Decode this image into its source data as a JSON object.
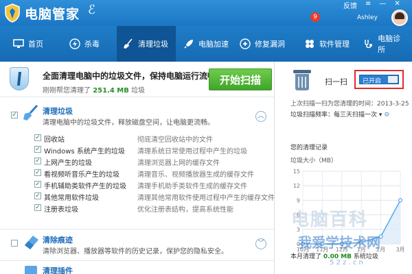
{
  "app": {
    "title": "电脑管家",
    "user": "Ashley",
    "feedback": "反馈"
  },
  "nav": {
    "items": [
      {
        "label": "首页",
        "icon": "monitor-icon"
      },
      {
        "label": "杀毒",
        "icon": "lightning-icon"
      },
      {
        "label": "清理垃圾",
        "icon": "broom-icon"
      },
      {
        "label": "电脑加速",
        "icon": "rocket-icon"
      },
      {
        "label": "修复漏洞",
        "icon": "patch-icon"
      },
      {
        "label": "软件管理",
        "icon": "apps-icon"
      },
      {
        "label": "电脑诊所",
        "icon": "stethoscope-icon"
      }
    ],
    "active": "清理垃圾",
    "badge": "9"
  },
  "header": {
    "title": "全面清理电脑中的垃圾文件，保持电脑运行流畅",
    "sub_prefix": "刚刚帮您清理了",
    "sub_value": "251.4 MB",
    "sub_suffix": "垃圾",
    "scan_button": "开始扫描"
  },
  "sections": [
    {
      "title": "清理垃圾",
      "desc": "清理电脑中的垃圾文件，释放磁盘空间，让电脑更流畅。",
      "checked": true
    },
    {
      "title": "清除痕迹",
      "desc": "清除浏览器、播放器等软件的历史记录，保护您的隐私安全。",
      "checked": false
    },
    {
      "title": "清理插件",
      "desc": "",
      "checked": false
    }
  ],
  "items": [
    {
      "label": "回收站",
      "desc": "彻底清空回收站中的文件"
    },
    {
      "label": "Windows 系统产生的垃圾",
      "desc": "清理系统日常使用过程中产生的垃圾"
    },
    {
      "label": "上网产生的垃圾",
      "desc": "清理浏览器上网的缓存文件"
    },
    {
      "label": "看视频听音乐产生的垃圾",
      "desc": "清理音乐、视频播放器生成的缓存文件"
    },
    {
      "label": "手机辅助类软件产生的垃圾",
      "desc": "清理手机助手类软件生成的缓存文件"
    },
    {
      "label": "其他常用软件垃圾",
      "desc": "清理其他常用软件使用过程中产生的缓存文件"
    },
    {
      "label": "注册表垃圾",
      "desc": "优化注册表结构，提高系统性能"
    }
  ],
  "side": {
    "scan_label": "扫一扫",
    "toggle_label": "已开启",
    "toggle_on": true,
    "last_scan": "上次扫描一扫为您清理的时间：2013-3-25",
    "freq_label": "垃圾扫描频率：每三天扫描一次",
    "record_title": "您的清理记录",
    "unit_label": "垃圾大小（MB）",
    "month_prefix": "本月清理了",
    "month_value": "0.00 MB",
    "month_suffix": "系统垃圾"
  },
  "watermark": {
    "line1": "电脑百科",
    "line2": "我爱学技术网",
    "line3": "5 2 z . c n"
  },
  "chart_data": {
    "type": "line",
    "title": "您的清理记录",
    "ylabel": "垃圾大小（MB）",
    "categories": [
      "10月",
      "11月",
      "12月",
      "1月",
      "2月",
      "3月"
    ],
    "values": [
      0,
      0,
      0,
      0.3,
      1.5,
      9
    ],
    "yticks": [
      "0",
      "3",
      "6",
      "9",
      "12",
      "15"
    ],
    "ylim": [
      0,
      15
    ],
    "grid": true,
    "colors": {
      "line": "#5aa6e6",
      "fill": "#dcebfa"
    }
  },
  "colors": {
    "brand": "#1b76c4",
    "accent_green": "#3fa52a",
    "highlight_red": "#e02a2a"
  }
}
